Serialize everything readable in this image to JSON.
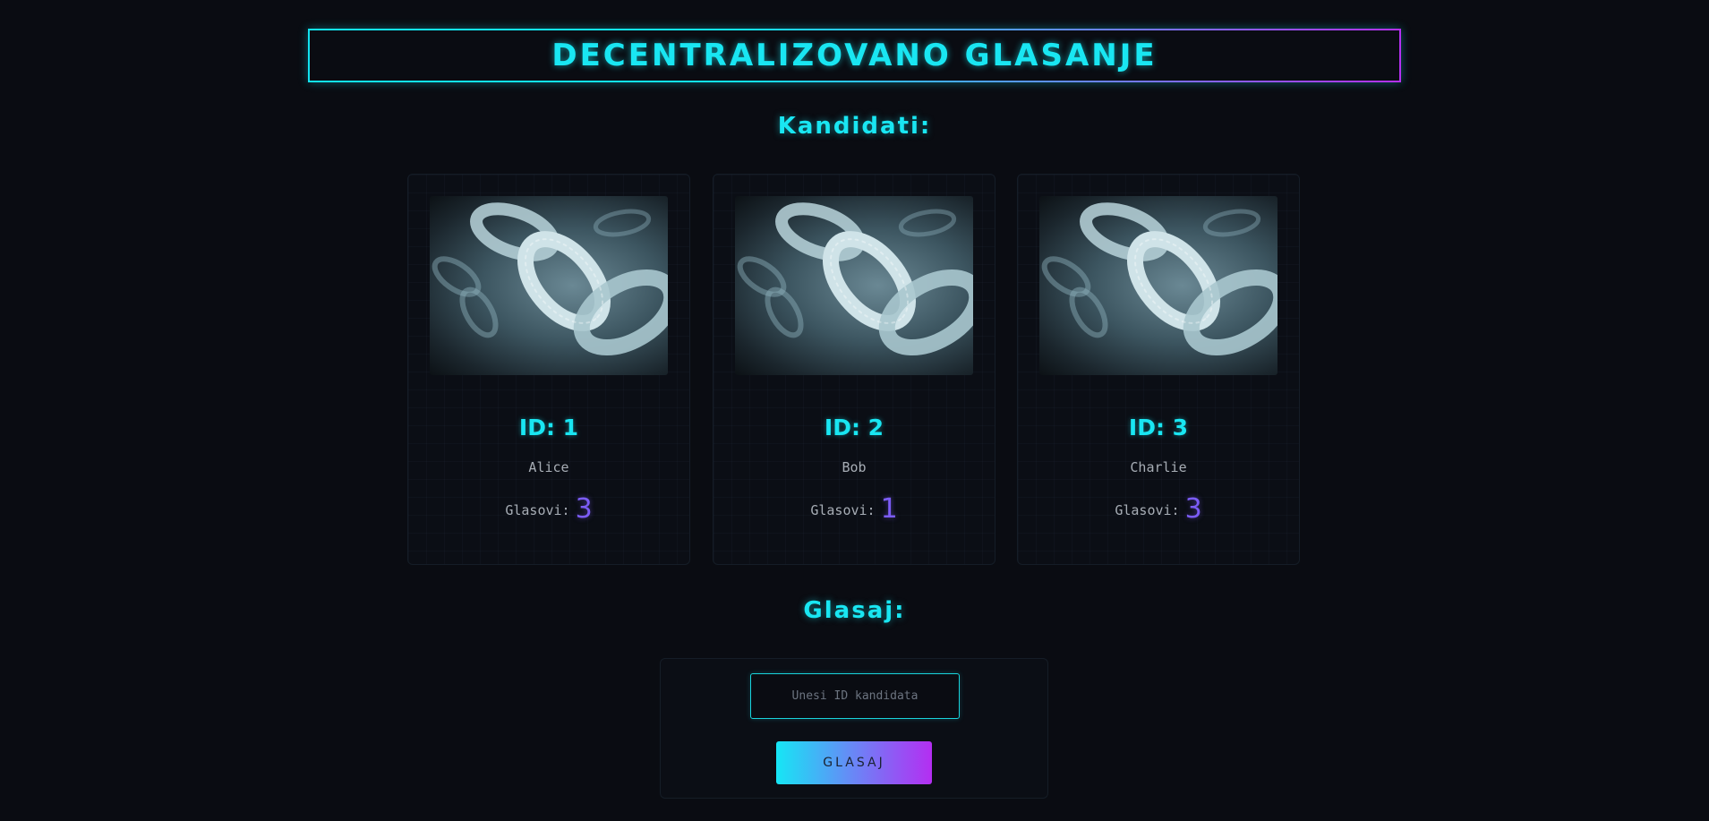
{
  "header": {
    "title": "DECENTRALIZOVANO GLASANJE"
  },
  "candidates_section": {
    "title": "Kandidati:",
    "votes_label": "Glasovi:",
    "items": [
      {
        "id_label": "ID: 1",
        "name": "Alice",
        "votes": "3"
      },
      {
        "id_label": "ID: 2",
        "name": "Bob",
        "votes": "1"
      },
      {
        "id_label": "ID: 3",
        "name": "Charlie",
        "votes": "3"
      }
    ]
  },
  "vote_section": {
    "title": "Glasaj:",
    "input_placeholder": "Unesi ID kandidata",
    "input_value": "",
    "button_label": "GLASAJ"
  },
  "theme": {
    "accent": "#19e6f2",
    "accent_secondary": "#b430f0",
    "vote_count_color": "#7b5cf5",
    "background": "#0a0c12"
  },
  "icons": {
    "candidate_image": "blockchain-chain-image"
  }
}
